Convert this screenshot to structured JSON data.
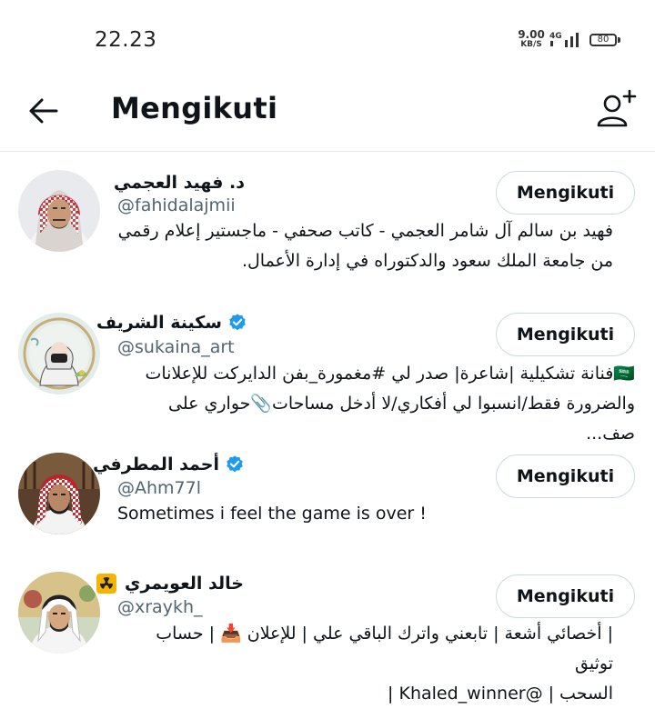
{
  "status_bar": {
    "time": "22.23",
    "net_speed_value": "9.00",
    "net_speed_unit": "KB/S",
    "network": "4G",
    "battery": "80"
  },
  "header": {
    "title": "Mengikuti",
    "back_icon": "arrow-left-icon",
    "add_user_icon": "add-user-icon"
  },
  "accounts": [
    {
      "name": "د. فهيد العجمي",
      "handle": "@fahidalajmii",
      "verified": false,
      "bio_lines": [
        "فهيد بن سالم آل شامر العجمي - كاتب صحفي - ماجستير إعلام رقمي",
        "من جامعة الملك سعود والدكتوراه في إدارة الأعمال."
      ],
      "button": "Mengikuti"
    },
    {
      "name": "سكينة الشريف",
      "handle": "@sukaina_art",
      "verified": true,
      "bio_lines": [
        "🇸🇦فنانة تشكيلية |شاعرة| صدر لي #مغمورة_بفن الدايركت للإعلانات",
        "والضرورة فقط/انسبوا لي أفكاري/لا أدخل مساحات📎حواري على صف..."
      ],
      "button": "Mengikuti"
    },
    {
      "name": "أحمد المطرفي",
      "handle": "@Ahm77l",
      "verified": true,
      "bio_lines": [
        "Sometimes i feel the game is over !"
      ],
      "button": "Mengikuti"
    },
    {
      "name": "خالد العويمري",
      "handle": "@xraykh_",
      "verified": false,
      "name_emoji": "☢",
      "bio_lines": [
        "| أخصائي أشعة | تابعني واترك الباقي علي | للإعلان 📥 | حساب توثيق",
        "السحب | @Khaled_winner |"
      ],
      "button": "Mengikuti"
    }
  ],
  "colors": {
    "verified_blue": "#1d9bf0",
    "handle_gray": "#536471",
    "text_dark": "#0f1419",
    "border": "#cfd9de"
  }
}
